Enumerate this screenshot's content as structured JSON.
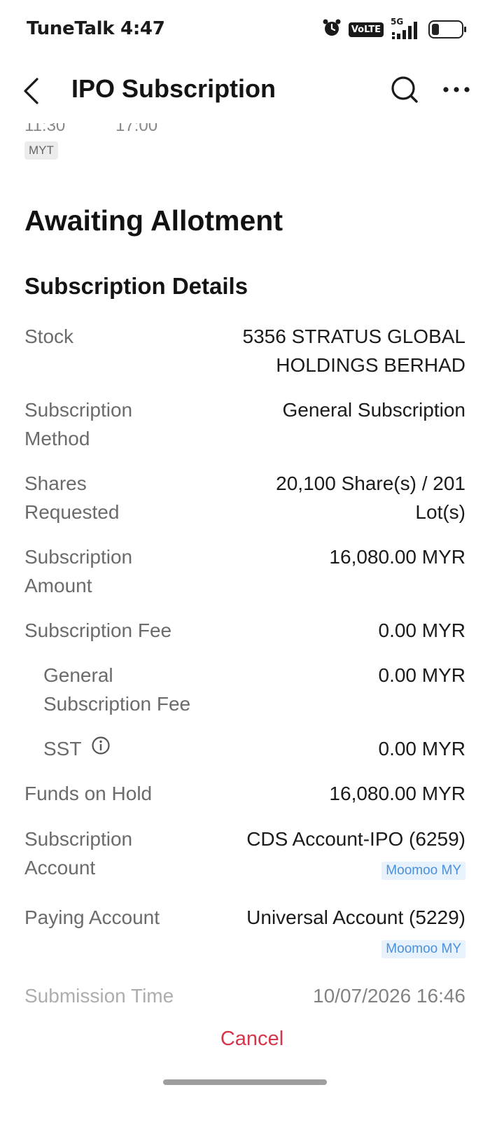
{
  "status_bar": {
    "carrier": "TuneTalk",
    "time": "4:47",
    "volte_label": "VoLTE",
    "network_label": "5G"
  },
  "nav": {
    "title": "IPO Subscription"
  },
  "header_remnant": {
    "time_left": "11:30",
    "time_right": "17:00",
    "timezone": "MYT"
  },
  "status_heading": "Awaiting Allotment",
  "section_heading": "Subscription Details",
  "details": {
    "stock_label": "Stock",
    "stock_value_line1": "5356 STRATUS GLOBAL",
    "stock_value_line2": "HOLDINGS BERHAD",
    "method_label_line1": "Subscription",
    "method_label_line2": "Method",
    "method_value": "General Subscription",
    "shares_label_line1": "Shares",
    "shares_label_line2": "Requested",
    "shares_value_line1": "20,100 Share(s) / 201",
    "shares_value_line2": "Lot(s)",
    "amount_label_line1": "Subscription",
    "amount_label_line2": "Amount",
    "amount_value": "16,080.00 MYR",
    "fee_label": "Subscription Fee",
    "fee_value": "0.00 MYR",
    "general_fee_label_line1": "General",
    "general_fee_label_line2": "Subscription Fee",
    "general_fee_value": "0.00 MYR",
    "sst_label": "SST",
    "sst_value": "0.00 MYR",
    "hold_label": "Funds on Hold",
    "hold_value": "16,080.00 MYR",
    "sub_account_label_line1": "Subscription",
    "sub_account_label_line2": "Account",
    "sub_account_value": "CDS Account-IPO (6259)",
    "sub_account_badge": "Moomoo MY",
    "paying_account_label": "Paying Account",
    "paying_account_value": "Universal Account (5229)",
    "paying_account_badge": "Moomoo MY",
    "submission_label": "Submission Time",
    "submission_value": "10/07/2026 16:46"
  },
  "actions": {
    "cancel_label": "Cancel"
  },
  "colors": {
    "cancel": "#d6344b",
    "badge_text": "#4a90d9",
    "badge_bg": "#e8f2fc"
  }
}
